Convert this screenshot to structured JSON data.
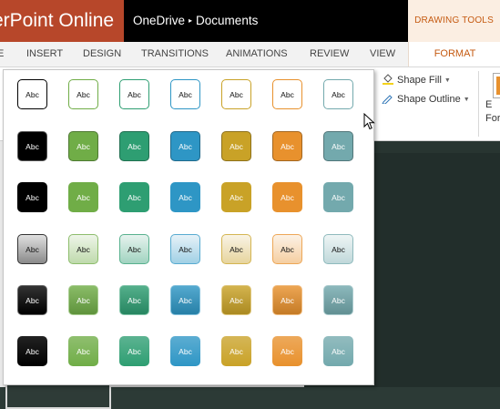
{
  "titlebar": {
    "app_name": "erPoint Online",
    "location": "OneDrive",
    "breadcrumb_sep": "▸",
    "folder": "Documents",
    "context_tab": "DRAWING TOOLS"
  },
  "tabs": [
    "E",
    "INSERT",
    "DESIGN",
    "TRANSITIONS",
    "ANIMATIONS",
    "REVIEW",
    "VIEW",
    "FORMAT"
  ],
  "active_tab": "FORMAT",
  "ribbon": {
    "shape_fill": "Shape Fill",
    "shape_outline": "Shape Outline",
    "partial_lines": [
      "E",
      "For"
    ]
  },
  "gallery": {
    "label": "Abc",
    "colors": [
      "#000000",
      "#70ad47",
      "#2e9e72",
      "#2e96c5",
      "#c9a227",
      "#e8912d",
      "#73a9ad"
    ],
    "style_rows": [
      "colored-outline",
      "colored-fill",
      "colored-fill-flat",
      "light-gradient",
      "intense-gradient",
      "moderate-gradient"
    ]
  },
  "colors": {
    "accent": "#b7472a",
    "context": "#c55a11"
  }
}
